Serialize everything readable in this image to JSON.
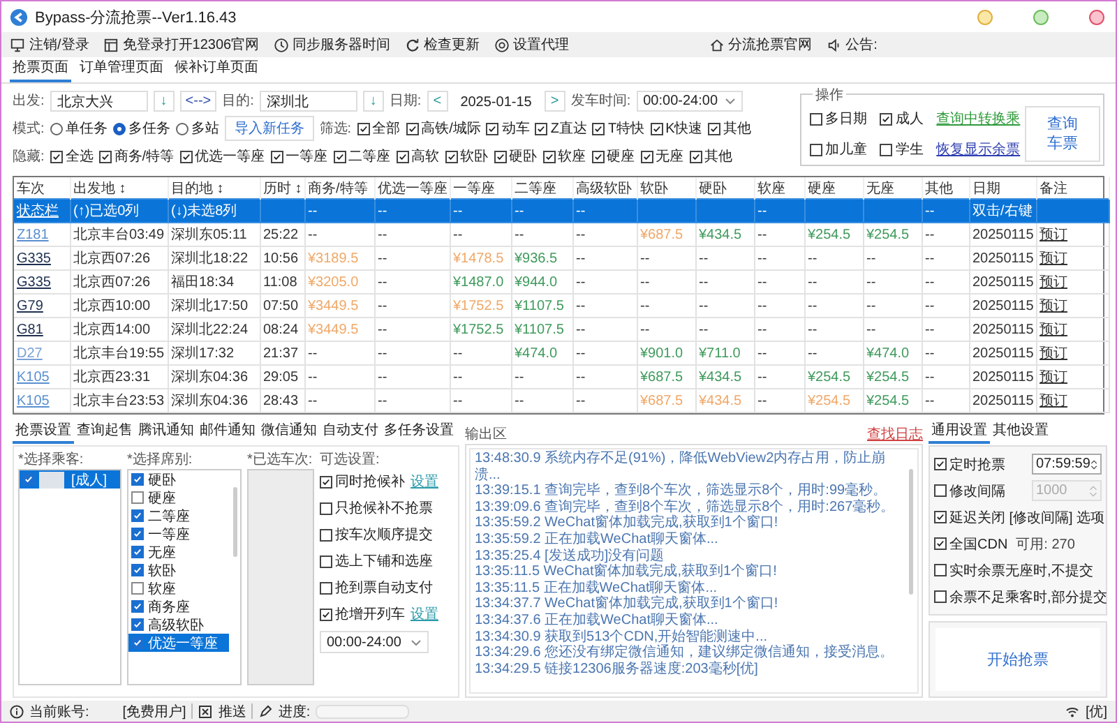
{
  "window": {
    "title": "Bypass-分流抢票--Ver1.16.43"
  },
  "menu": [
    "注销/登录",
    "免登录打开12306官网",
    "同步服务器时间",
    "检查更新",
    "设置代理"
  ],
  "menu_right": [
    "分流抢票官网",
    "公告:"
  ],
  "tabs": [
    {
      "label": "抢票页面",
      "selected": true
    },
    {
      "label": "订单管理页面",
      "selected": false
    },
    {
      "label": "候补订单页面",
      "selected": false
    }
  ],
  "route": {
    "from_label": "出发:",
    "from": "北京大兴",
    "from_pick": "↓",
    "swap": "<-->",
    "to_label": "目的:",
    "to": "深圳北",
    "to_pick": "↓",
    "date_label": "日期:",
    "date_prev": "<",
    "date": "2025-01-15",
    "date_next": ">",
    "time_label": "发车时间:",
    "time": "00:00-24:00"
  },
  "mode": {
    "label": "模式:",
    "options": [
      {
        "label": "单任务",
        "selected": false
      },
      {
        "label": "多任务",
        "selected": true
      },
      {
        "label": "多站",
        "selected": false
      }
    ],
    "import_button": "导入新任务"
  },
  "filter": {
    "label": "筛选:",
    "items": [
      {
        "label": "全部",
        "checked": true
      },
      {
        "label": "高铁/城际",
        "checked": true
      },
      {
        "label": "动车",
        "checked": true
      },
      {
        "label": "Z直达",
        "checked": true
      },
      {
        "label": "T特快",
        "checked": true
      },
      {
        "label": "K快速",
        "checked": true
      },
      {
        "label": "其他",
        "checked": true
      }
    ]
  },
  "hide": {
    "label": "隐藏:",
    "items": [
      {
        "label": "全选",
        "checked": true
      },
      {
        "label": "商务/特等",
        "checked": true
      },
      {
        "label": "优选一等座",
        "checked": true
      },
      {
        "label": "一等座",
        "checked": true
      },
      {
        "label": "二等座",
        "checked": true
      },
      {
        "label": "高软",
        "checked": true
      },
      {
        "label": "软卧",
        "checked": true
      },
      {
        "label": "硬卧",
        "checked": true
      },
      {
        "label": "软座",
        "checked": true
      },
      {
        "label": "硬座",
        "checked": true
      },
      {
        "label": "无座",
        "checked": true
      },
      {
        "label": "其他",
        "checked": true
      }
    ]
  },
  "ops": {
    "title": "操作",
    "items": [
      {
        "label": "多日期",
        "checked": false
      },
      {
        "label": "成人",
        "checked": true
      },
      {
        "label": "加儿童",
        "checked": false
      },
      {
        "label": "学生",
        "checked": false
      }
    ],
    "links": [
      {
        "label": "查询中转换乘",
        "color": "#2e9a3a"
      },
      {
        "label": "恢复显示余票",
        "color": "#2d3db0"
      }
    ],
    "query_button": "查询车票"
  },
  "table": {
    "columns": [
      {
        "label": "车次",
        "kind": "link"
      },
      {
        "label": "出发地 ↕",
        "kind": "text"
      },
      {
        "label": "目的地 ↕",
        "kind": "text"
      },
      {
        "label": "历时 ↕",
        "kind": "text"
      },
      {
        "label": "商务/特等",
        "kind": "text"
      },
      {
        "label": "优选一等座",
        "kind": "text"
      },
      {
        "label": "一等座",
        "kind": "text"
      },
      {
        "label": "二等座",
        "kind": "text"
      },
      {
        "label": "高级软卧",
        "kind": "text"
      },
      {
        "label": "软卧",
        "kind": "text"
      },
      {
        "label": "硬卧",
        "kind": "text"
      },
      {
        "label": "软座",
        "kind": "text"
      },
      {
        "label": "硬座",
        "kind": "text"
      },
      {
        "label": "无座",
        "kind": "text"
      },
      {
        "label": "其他",
        "kind": "text"
      },
      {
        "label": "日期",
        "kind": "text"
      },
      {
        "label": "备注",
        "kind": "link"
      }
    ],
    "rows": [
      {
        "selected": true,
        "cells": [
          "状态栏",
          "(↑)已选0列",
          "(↓)未选8列",
          "",
          "--",
          "--",
          "--",
          "--",
          "--",
          "",
          "",
          "--",
          "",
          "",
          "--",
          "双击/右键",
          ""
        ]
      },
      {
        "selected": false,
        "cells": [
          {
            "text": "Z181",
            "color": "#5b8fd0"
          },
          "北京丰台03:49",
          "深圳东05:11",
          "25:22",
          "--",
          "--",
          "--",
          "--",
          "--",
          {
            "text": "¥687.5",
            "color": "#f0a868"
          },
          {
            "text": "¥434.5",
            "color": "#3f9a5c"
          },
          "--",
          {
            "text": "¥254.5",
            "color": "#3f9a5c"
          },
          {
            "text": "¥254.5",
            "color": "#3f9a5c"
          },
          "--",
          "20250115",
          "预订"
        ]
      },
      {
        "selected": false,
        "cells": [
          {
            "text": "G335",
            "color": "#1f3050"
          },
          "北京西07:26",
          "深圳北18:22",
          "10:56",
          {
            "text": "¥3189.5",
            "color": "#f0a868"
          },
          "--",
          {
            "text": "¥1478.5",
            "color": "#f0a868"
          },
          {
            "text": "¥936.5",
            "color": "#3f9a5c"
          },
          "--",
          "--",
          "--",
          "--",
          "--",
          "--",
          "--",
          "20250115",
          "预订"
        ]
      },
      {
        "selected": false,
        "cells": [
          {
            "text": "G335",
            "color": "#1f3050"
          },
          "北京西07:26",
          "福田18:34",
          "11:08",
          {
            "text": "¥3205.0",
            "color": "#f0a868"
          },
          "--",
          {
            "text": "¥1487.0",
            "color": "#3f9a5c"
          },
          {
            "text": "¥944.0",
            "color": "#3f9a5c"
          },
          "--",
          "--",
          "--",
          "--",
          "--",
          "--",
          "--",
          "20250115",
          "预订"
        ]
      },
      {
        "selected": false,
        "cells": [
          {
            "text": "G79",
            "color": "#1f3050"
          },
          "北京西10:00",
          "深圳北17:50",
          "07:50",
          {
            "text": "¥3449.5",
            "color": "#f0a868"
          },
          "--",
          {
            "text": "¥1752.5",
            "color": "#f0a868"
          },
          {
            "text": "¥1107.5",
            "color": "#3f9a5c"
          },
          "--",
          "--",
          "--",
          "--",
          "--",
          "--",
          "--",
          "20250115",
          "预订"
        ]
      },
      {
        "selected": false,
        "cells": [
          {
            "text": "G81",
            "color": "#1f3050"
          },
          "北京西14:00",
          "深圳北22:24",
          "08:24",
          {
            "text": "¥3449.5",
            "color": "#f0a868"
          },
          "--",
          {
            "text": "¥1752.5",
            "color": "#3f9a5c"
          },
          {
            "text": "¥1107.5",
            "color": "#3f9a5c"
          },
          "--",
          "--",
          "--",
          "--",
          "--",
          "--",
          "--",
          "20250115",
          "预订"
        ]
      },
      {
        "selected": false,
        "cells": [
          {
            "text": "D27",
            "color": "#7aa0d8"
          },
          "北京丰台19:55",
          "深圳17:32",
          "21:37",
          "--",
          "--",
          "--",
          {
            "text": "¥474.0",
            "color": "#3f9a5c"
          },
          "--",
          {
            "text": "¥901.0",
            "color": "#3f9a5c"
          },
          {
            "text": "¥711.0",
            "color": "#3f9a5c"
          },
          "--",
          "--",
          {
            "text": "¥474.0",
            "color": "#3f9a5c"
          },
          "--",
          "20250115",
          "预订"
        ]
      },
      {
        "selected": false,
        "cells": [
          {
            "text": "K105",
            "color": "#5b8fd0"
          },
          "北京西23:31",
          "深圳东04:36",
          "29:05",
          "--",
          "--",
          "--",
          "--",
          "--",
          {
            "text": "¥687.5",
            "color": "#3f9a5c"
          },
          {
            "text": "¥434.5",
            "color": "#3f9a5c"
          },
          "--",
          {
            "text": "¥254.5",
            "color": "#3f9a5c"
          },
          {
            "text": "¥254.5",
            "color": "#3f9a5c"
          },
          "--",
          "20250115",
          "预订"
        ]
      },
      {
        "selected": false,
        "cells": [
          {
            "text": "K105",
            "color": "#5b8fd0"
          },
          "北京丰台23:53",
          "深圳东04:36",
          "28:43",
          "--",
          "--",
          "--",
          "--",
          "--",
          {
            "text": "¥687.5",
            "color": "#f0a868"
          },
          {
            "text": "¥434.5",
            "color": "#f0a868"
          },
          "--",
          {
            "text": "¥254.5",
            "color": "#f0a868"
          },
          {
            "text": "¥254.5",
            "color": "#3f9a5c"
          },
          "--",
          "20250115",
          "预订"
        ]
      }
    ]
  },
  "bottom_tabs": [
    {
      "label": "抢票设置",
      "selected": true
    },
    {
      "label": "查询起售",
      "selected": false
    },
    {
      "label": "腾讯通知",
      "selected": false
    },
    {
      "label": "邮件通知",
      "selected": false
    },
    {
      "label": "微信通知",
      "selected": false
    },
    {
      "label": "自动支付",
      "selected": false
    },
    {
      "label": "多任务设置",
      "selected": false
    }
  ],
  "passengers": {
    "label": "*选择乘客:",
    "items": [
      {
        "label": "[成人]",
        "checked": true,
        "selected": true
      }
    ]
  },
  "seats": {
    "label": "*选择席别:",
    "items": [
      {
        "label": "硬卧",
        "checked": true,
        "selected": false
      },
      {
        "label": "硬座",
        "checked": false,
        "selected": false
      },
      {
        "label": "二等座",
        "checked": true,
        "selected": false
      },
      {
        "label": "一等座",
        "checked": true,
        "selected": false
      },
      {
        "label": "无座",
        "checked": true,
        "selected": false
      },
      {
        "label": "软卧",
        "checked": true,
        "selected": false
      },
      {
        "label": "软座",
        "checked": false,
        "selected": false
      },
      {
        "label": "商务座",
        "checked": true,
        "selected": false
      },
      {
        "label": "高级软卧",
        "checked": true,
        "selected": false
      },
      {
        "label": "优选一等座",
        "checked": true,
        "selected": true
      }
    ]
  },
  "trains": {
    "label": "*已选车次:"
  },
  "options": {
    "label": "可选设置:",
    "items": [
      {
        "label": "同时抢候补",
        "checked": true,
        "link": "设置"
      },
      {
        "label": "只抢候补不抢票",
        "checked": false
      },
      {
        "label": "按车次顺序提交",
        "checked": false
      },
      {
        "label": "选上下铺和选座",
        "checked": false
      },
      {
        "label": "抢到票自动支付",
        "checked": false
      },
      {
        "label": "抢增开列车",
        "checked": true,
        "link": "设置"
      }
    ],
    "time": "00:00-24:00"
  },
  "output": {
    "title": "输出区",
    "search_link": "查找日志",
    "lines": [
      "13:48:30.9 系统内存不足(91%)，降低WebView2内存占用，防止崩溃...",
      "13:39:15.1 查询完毕，查到8个车次，筛选显示8个，用时:99毫秒。",
      "13:39:09.6 查询完毕，查到8个车次，筛选显示8个，用时:267毫秒。",
      "13:35:59.2 WeChat窗体加载完成,获取到1个窗口!",
      "13:35:59.2 正在加载WeChat聊天窗体...",
      "13:35:25.4 [发送成功]没有问题",
      "13:35:11.5 WeChat窗体加载完成,获取到1个窗口!",
      "13:35:11.5 正在加载WeChat聊天窗体...",
      "13:34:37.7 WeChat窗体加载完成,获取到1个窗口!",
      "13:34:37.6 正在加载WeChat聊天窗体...",
      "13:34:30.9 获取到513个CDN,开始智能测速中...",
      "13:34:29.6 您还没有绑定微信通知，建议绑定微信通知，接受消息。",
      "13:34:29.5 链接12306服务器速度:203毫秒[优]"
    ]
  },
  "general": {
    "tabs": [
      {
        "label": "通用设置",
        "selected": true
      },
      {
        "label": "其他设置",
        "selected": false
      }
    ],
    "items": [
      {
        "kind": "spin",
        "label": "定时抢票",
        "checked": true,
        "value": "07:59:59",
        "disabled": false
      },
      {
        "kind": "spin",
        "label": "修改间隔",
        "checked": false,
        "value": "1000",
        "disabled": true
      },
      {
        "kind": "check",
        "label": "延迟关闭 [修改间隔] 选项",
        "checked": true
      },
      {
        "kind": "note",
        "label": "全国CDN",
        "checked": true,
        "note": "可用: 270"
      },
      {
        "kind": "check",
        "label": "实时余票无座时,不提交",
        "checked": false
      },
      {
        "kind": "check",
        "label": "余票不足乘客时,部分提交",
        "checked": false
      }
    ],
    "start_button": "开始抢票"
  },
  "status_bar": {
    "account_label": "当前账号:",
    "account": "[免费用户]",
    "push": "推送",
    "progress_label": "进度:",
    "level": 0,
    "quality": "[优]"
  }
}
